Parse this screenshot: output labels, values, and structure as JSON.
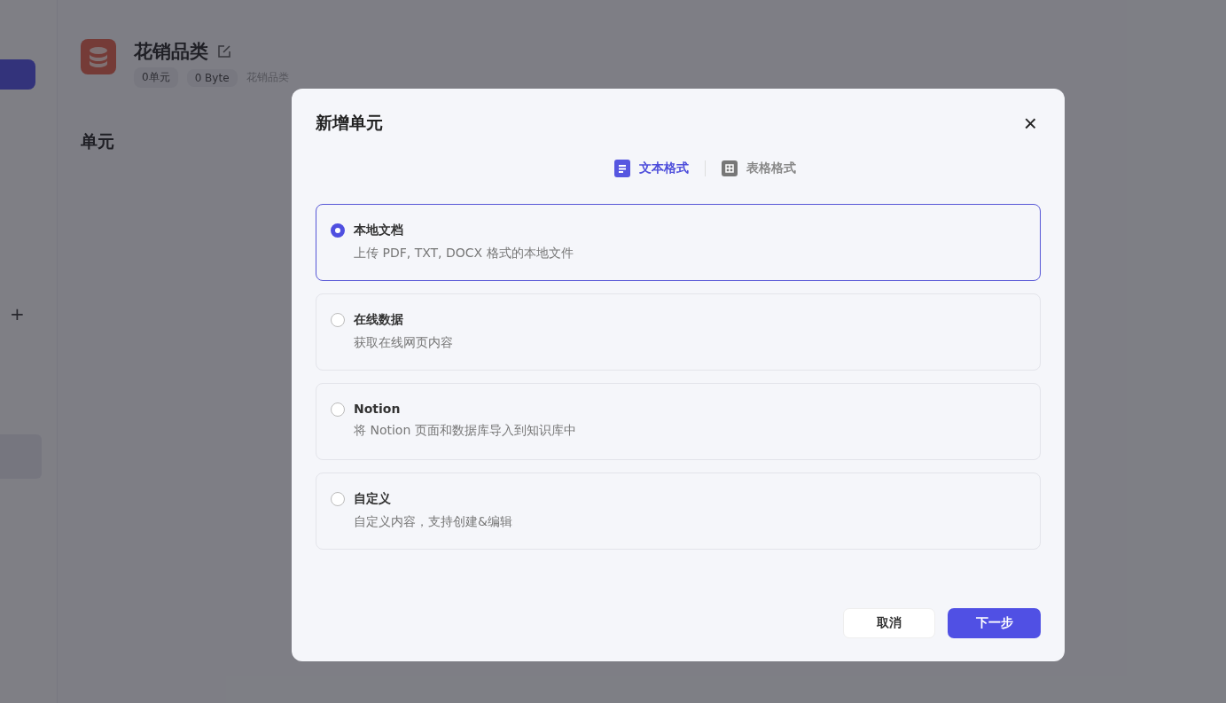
{
  "page": {
    "title": "花销品类",
    "badges": [
      "0单元",
      "0 Byte"
    ],
    "description": "花销品类",
    "section_title": "单元",
    "sidebar_add": "+"
  },
  "dialog": {
    "title": "新增单元",
    "close": "×",
    "tabs": [
      {
        "label": "文本格式",
        "selected": true,
        "kind": "doc"
      },
      {
        "label": "表格格式",
        "selected": false,
        "kind": "grid"
      }
    ],
    "options": [
      {
        "title": "本地文档",
        "description": "上传 PDF, TXT, DOCX 格式的本地文件",
        "selected": true
      },
      {
        "title": "在线数据",
        "description": "获取在线网页内容",
        "selected": false
      },
      {
        "title": "Notion",
        "description": "将 Notion 页面和数据库导入到知识库中",
        "selected": false
      },
      {
        "title": "自定义",
        "description": "自定义内容，支持创建&编辑",
        "selected": false
      }
    ],
    "cancel": "取消",
    "next": "下一步"
  }
}
